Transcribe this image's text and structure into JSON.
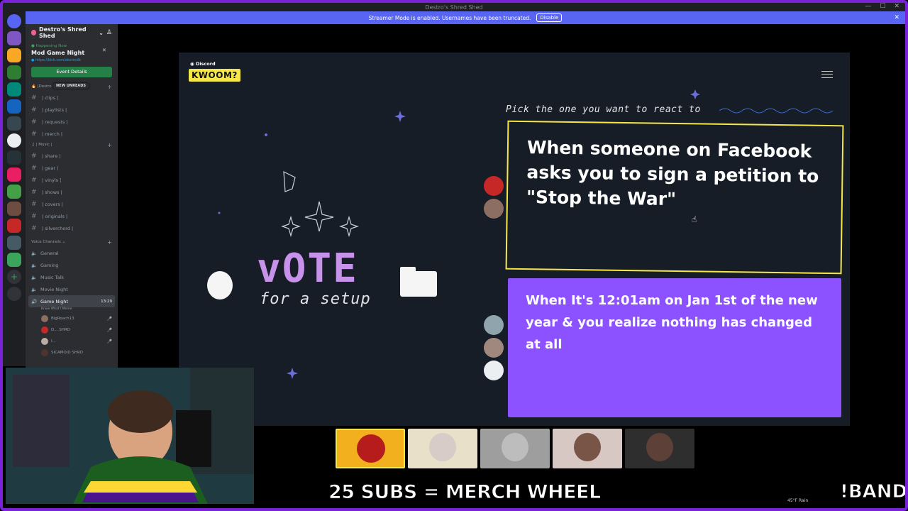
{
  "window": {
    "title": "Destro's Shred Shed"
  },
  "streamer_banner": {
    "text": "Streamer Mode is enabled. Usernames have been truncated.",
    "disable_label": "Disable"
  },
  "sidebar": {
    "server_name": "Destro's Shred Shed",
    "event": {
      "happening_label": "Happening Now",
      "title": "Mod Game Night",
      "link": "https://kick.com/destrodb",
      "button_label": "Event Details"
    },
    "new_unreads_label": "NEW UNREADS",
    "category_destro": "Destro",
    "channels_top": [
      {
        "label": "| clips |"
      },
      {
        "label": "| playlists |"
      },
      {
        "label": "| requests |"
      },
      {
        "label": "| merch |"
      }
    ],
    "category_music": "| Music |",
    "channels_music": [
      {
        "label": "| share |"
      },
      {
        "label": "| gear |"
      },
      {
        "label": "| vinyls |"
      },
      {
        "label": "| shows |"
      },
      {
        "label": "| covers |"
      },
      {
        "label": "| originals |"
      },
      {
        "label": "| silverchord |"
      }
    ],
    "voice_category": "Voice Channels",
    "voice_channels": [
      {
        "label": "General"
      },
      {
        "label": "Gaming"
      },
      {
        "label": "Music Talk"
      },
      {
        "label": "Movie Night"
      }
    ],
    "active_voice": {
      "label": "Game Night",
      "time": "13:29",
      "subtitle": "Know What I Meme"
    },
    "voice_users": [
      {
        "name": "BigRoach13"
      },
      {
        "name": "D... SHRD"
      },
      {
        "name": "I..."
      },
      {
        "name": "SICAMOID SHRD"
      }
    ]
  },
  "kwoom": {
    "discord_label": "Discord",
    "logo_text": "KWOOM?",
    "pick_prompt": "Pick the one you want to react to",
    "vote_word": "vOTE",
    "vote_sub": "for a setup",
    "card1_text": "When someone on Facebook asks you to sign a petition to \"Stop the War\"",
    "card2_text": "When It's 12:01am on Jan 1st of the new year & you realize nothing has changed at all"
  },
  "overlay": {
    "subs_text": "25 SUBS = MERCH WHEEL",
    "band_text": "!BAND",
    "weather": "45°F Rain"
  },
  "colors": {
    "accent_yellow": "#f5e74a",
    "card_purple": "#8c52ff",
    "frame_purple": "#7a22d8",
    "discord_blurple": "#5865f2"
  }
}
